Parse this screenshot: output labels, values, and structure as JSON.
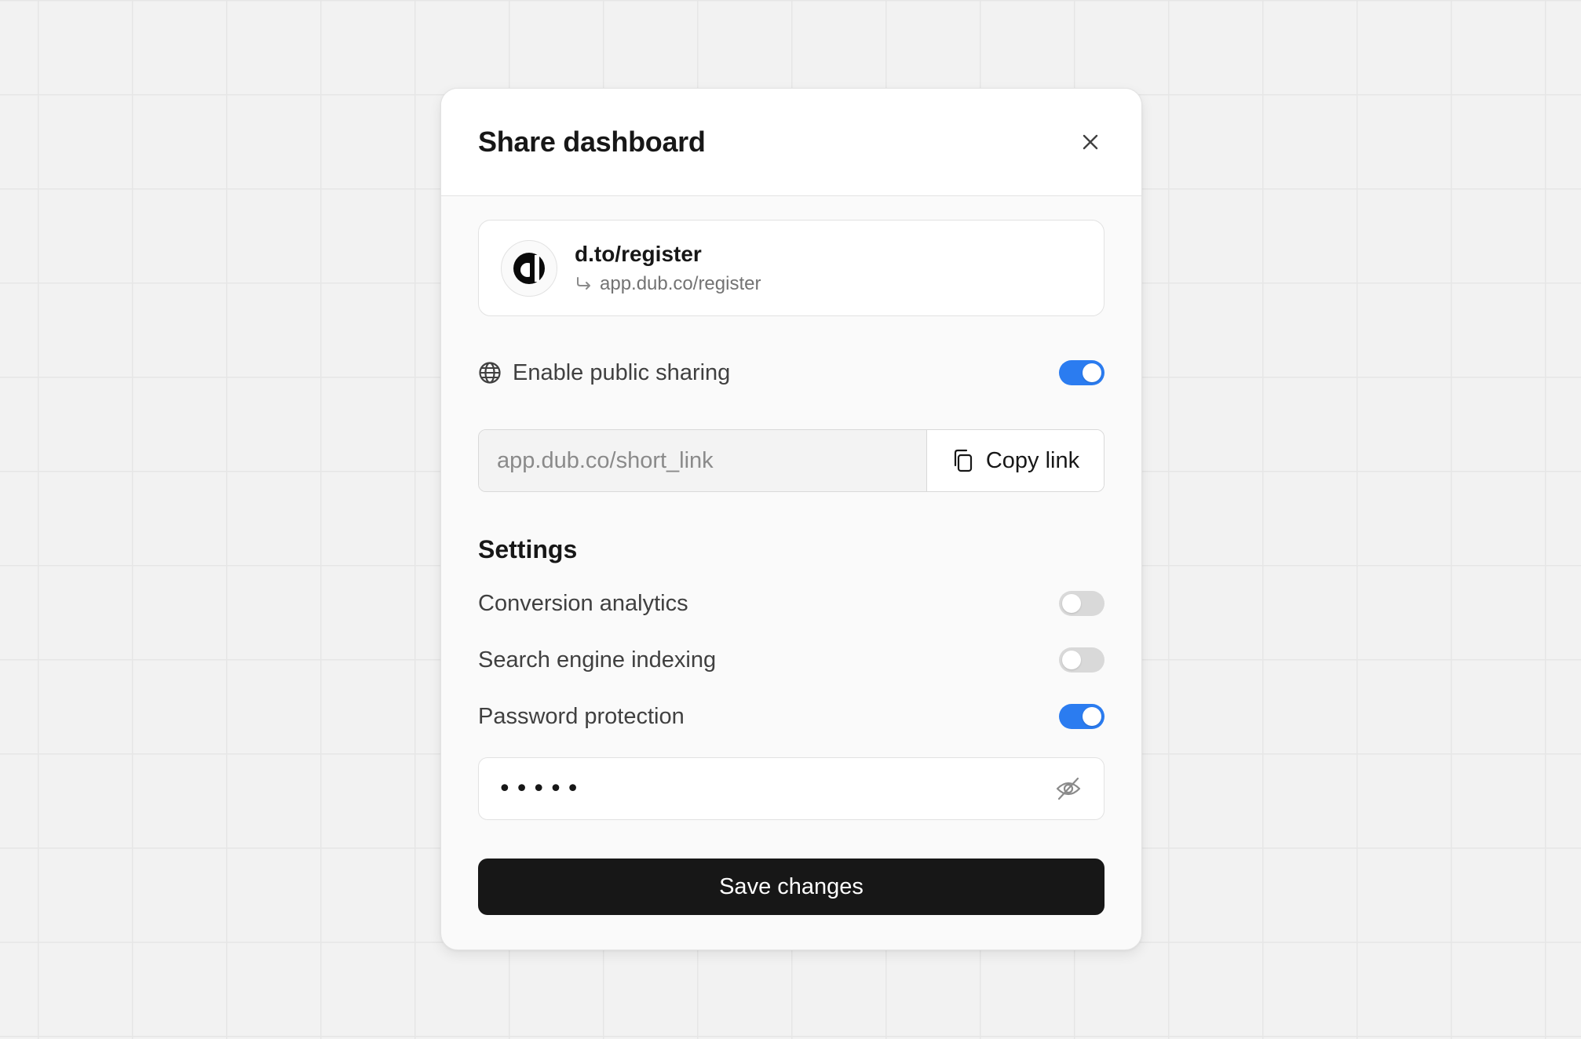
{
  "modal": {
    "title": "Share dashboard",
    "close_icon": "close-icon"
  },
  "link_card": {
    "logo_icon": "dub-logo",
    "short_link": "d.to/register",
    "redirect_icon": "corner-down-right-arrow-icon",
    "destination": "app.dub.co/register"
  },
  "public_sharing": {
    "icon": "globe-icon",
    "label": "Enable public sharing",
    "enabled": true
  },
  "share_link": {
    "placeholder": "app.dub.co/short_link",
    "copy_icon": "copy-icon",
    "copy_label": "Copy link"
  },
  "settings": {
    "title": "Settings",
    "items": [
      {
        "label": "Conversion analytics",
        "enabled": false
      },
      {
        "label": "Search engine indexing",
        "enabled": false
      },
      {
        "label": "Password protection",
        "enabled": true
      }
    ]
  },
  "password": {
    "masked_value": "•••••",
    "visibility_icon": "eye-off-icon"
  },
  "save_button": {
    "label": "Save changes"
  },
  "colors": {
    "accent": "#2b7cf0",
    "primary_button": "#171717",
    "toggle_off": "#d9d9d9"
  }
}
